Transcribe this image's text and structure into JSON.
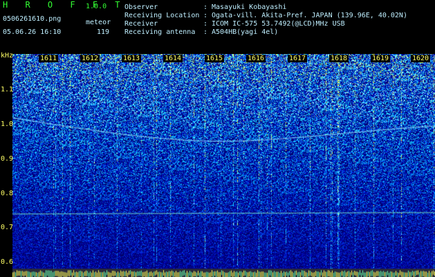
{
  "app": {
    "name": "H R O F F T",
    "version": "1.0.0"
  },
  "file": {
    "name": "0506261610.png",
    "datetime": "05.06.26 16:10"
  },
  "meteor": {
    "label": "meteor",
    "count": "119"
  },
  "info": [
    {
      "key": "Observer",
      "sep": ":",
      "value": "Masayuki Kobayashi"
    },
    {
      "key": "Receiving Location",
      "sep": ":",
      "value": "Ogata-vill. Akita-Pref. JAPAN (139.96E, 40.02N)"
    },
    {
      "key": "Receiver",
      "sep": ":",
      "value": "ICOM IC-575 53.7492(@LCD)MHz USB"
    },
    {
      "key": "Receiving antenna",
      "sep": ":",
      "value": "A504HB(yagi 4el)"
    }
  ],
  "y_axis": {
    "unit": "kHz",
    "ticks": [
      "1.1",
      "1.0",
      "0.9",
      "0.8",
      "0.7",
      "0.6"
    ]
  },
  "time_ticks": [
    "1611",
    "1612",
    "1613",
    "1614",
    "1615",
    "1616",
    "1617",
    "1618",
    "1619",
    "1620"
  ],
  "colors": {
    "bg_dark": "#000080",
    "accent": "#33ff33",
    "text": "#bfefff",
    "tick": "#ffff66"
  }
}
